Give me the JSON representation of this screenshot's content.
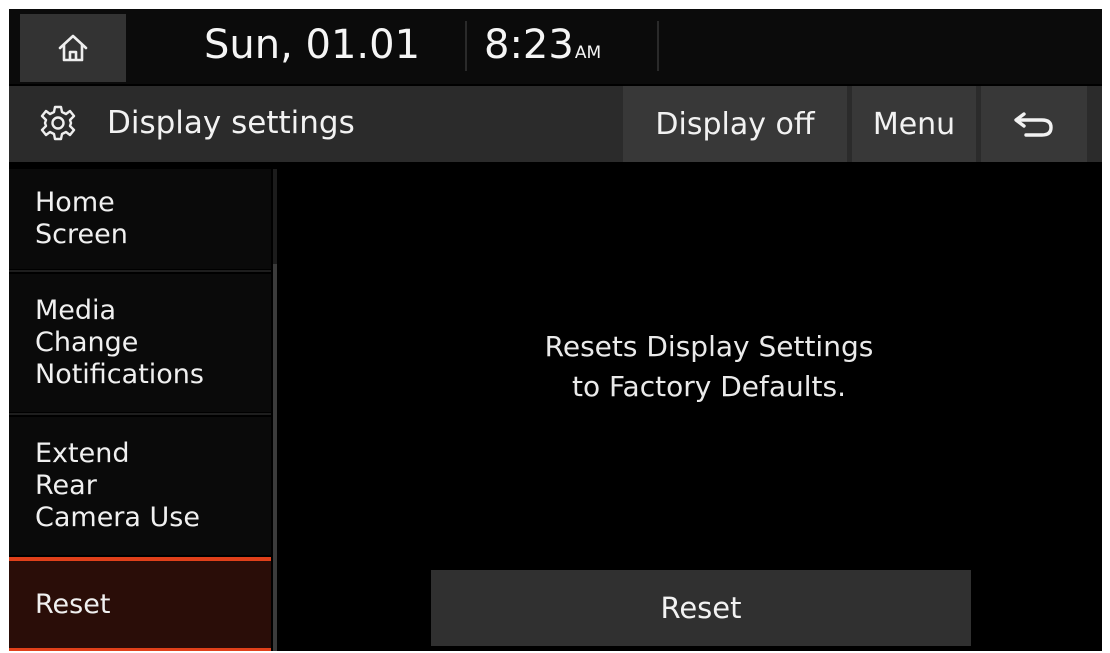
{
  "status_bar": {
    "date": "Sun, 01.01",
    "time": "8:23",
    "ampm": "AM",
    "home_icon": "home-icon"
  },
  "header": {
    "title": "Display settings",
    "settings_icon": "gear-icon",
    "display_off_label": "Display off",
    "menu_label": "Menu",
    "back_icon": "back-arrow-icon"
  },
  "sidebar": {
    "items": [
      {
        "label": "Home\nScreen",
        "selected": false
      },
      {
        "label": "Media\nChange\nNotifications",
        "selected": false
      },
      {
        "label": "Extend\nRear\nCamera Use",
        "selected": false
      },
      {
        "label": "Reset",
        "selected": true
      }
    ]
  },
  "content": {
    "description": "Resets Display Settings\nto Factory Defaults.",
    "reset_button_label": "Reset"
  },
  "colors": {
    "background": "#000000",
    "accent": "#e0401a",
    "selected_bg": "#2a0d08",
    "button_bg": "#383838"
  }
}
